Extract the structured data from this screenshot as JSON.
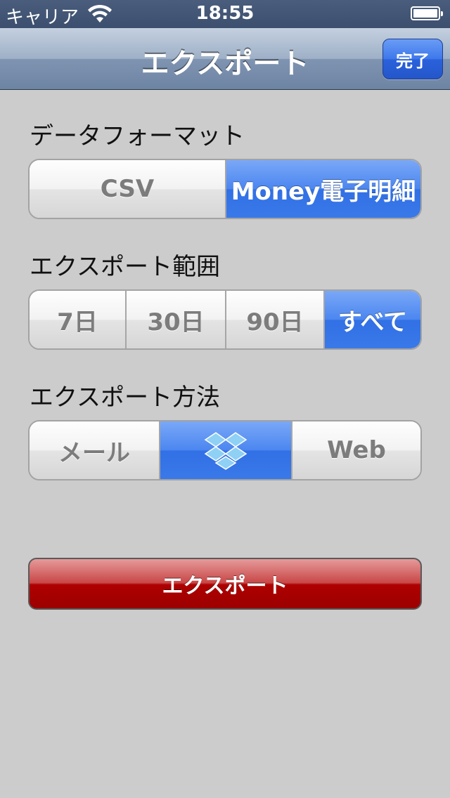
{
  "status_bar": {
    "carrier": "キャリア",
    "time": "18:55"
  },
  "nav": {
    "title": "エクスポート",
    "done_label": "完了"
  },
  "format": {
    "label": "データフォーマット",
    "options": [
      "CSV",
      "Money電子明細"
    ],
    "selected": "Money電子明細"
  },
  "range": {
    "label": "エクスポート範囲",
    "options": [
      "7日",
      "30日",
      "90日",
      "すべて"
    ],
    "selected": "すべて"
  },
  "method": {
    "label": "エクスポート方法",
    "options": [
      "メール",
      "dropbox-icon",
      "Web"
    ],
    "selected": "dropbox-icon"
  },
  "export_button": "エクスポート",
  "colors": {
    "accent": "#3a79e8",
    "export": "#ae0000",
    "nav": "#7f94b1"
  }
}
